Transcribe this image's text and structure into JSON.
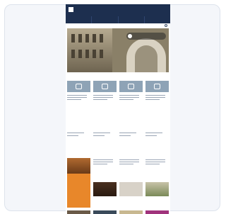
{
  "colors": {
    "header": "#1d2f4f",
    "accent": "#e8872a",
    "tile": "#8ea3b6",
    "purple": "#a0337c"
  }
}
